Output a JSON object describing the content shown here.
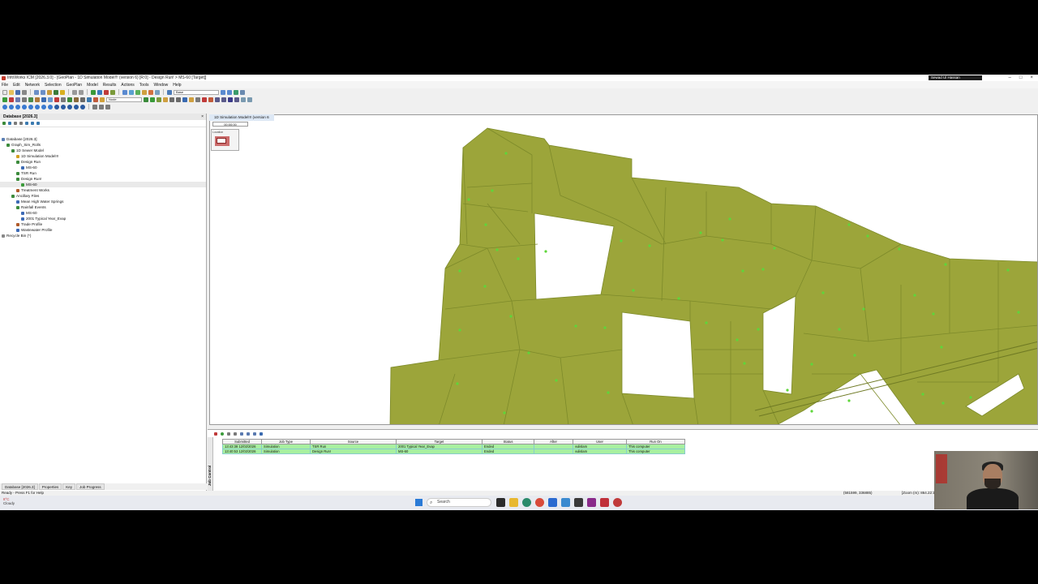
{
  "window": {
    "title": "InfoWorks ICM [2026.3.0] - [GeoPlan - 1D Simulation Model!!! (version 6) [R:0] - Design Run! > MS-60 [Target]]",
    "user": "Sewad Ul Hassan",
    "buttons": [
      "–",
      "□",
      "×"
    ]
  },
  "menu": [
    "File",
    "Edit",
    "Network",
    "Selection",
    "GeoPlan",
    "Model",
    "Results",
    "Actions",
    "Tools",
    "Window",
    "Help"
  ],
  "toolbar": {
    "node_select": "Node",
    "base_select": "Base"
  },
  "database_panel": {
    "title": "Database [2026.3]",
    "close": "×",
    "tree": [
      {
        "label": "Database [2026.3]",
        "level": 0,
        "color": "#5b7fb5"
      },
      {
        "label": "Graph_Sim_Rolls",
        "level": 1,
        "color": "#3c8b3c"
      },
      {
        "label": "1D Sewer Model",
        "level": 2,
        "color": "#3c8b3c"
      },
      {
        "label": "1D Simulation Model!!!",
        "level": 3,
        "color": "#d4a020"
      },
      {
        "label": "Design Run",
        "level": 3,
        "color": "#3c8b3c"
      },
      {
        "label": "MS-60",
        "level": 4,
        "color": "#3c6ab5"
      },
      {
        "label": "TSR Run",
        "level": 3,
        "color": "#3c8b3c"
      },
      {
        "label": "Design Run!",
        "level": 3,
        "color": "#3c8b3c"
      },
      {
        "label": "MS-60",
        "level": 4,
        "color": "#3c9b3c",
        "selected": true
      },
      {
        "label": "Treatment Works",
        "level": 3,
        "color": "#b05a2a"
      },
      {
        "label": "Ancillary Files",
        "level": 2,
        "color": "#3c8b3c"
      },
      {
        "label": "Mean High Water Springs",
        "level": 3,
        "color": "#3c6ab5"
      },
      {
        "label": "Rainfall Events",
        "level": 3,
        "color": "#3c8b3c"
      },
      {
        "label": "MS-60",
        "level": 4,
        "color": "#3c6ab5"
      },
      {
        "label": "2001 Typical Year_Evap",
        "level": 4,
        "color": "#3c6ab5"
      },
      {
        "label": "Trade Profile",
        "level": 3,
        "color": "#b05a2a"
      },
      {
        "label": "Wastewater Profile",
        "level": 3,
        "color": "#3c6ab5"
      },
      {
        "label": "Recycle Bin (*)",
        "level": 0,
        "color": "#888888"
      }
    ],
    "tabs": [
      "Database [2026.3]",
      "Properties",
      "Key",
      "Job Progress"
    ]
  },
  "geoplan": {
    "tab_label": "1D Simulation Model!!! (version 6",
    "time": "00:00:00",
    "locator_label": "Location",
    "polygon_fill": "#9ca53a",
    "polygon_stroke": "#7d8a2a",
    "node_color": "#5ed63a"
  },
  "job_control": {
    "side_label": "Job Control",
    "columns": [
      "Submitted",
      "Job Type",
      "Source",
      "Target",
      "Status",
      "After",
      "User",
      "Run On"
    ],
    "rows": [
      [
        "13:43:38 12/02/2026",
        "Simulation",
        "TSR Run",
        "2001 Typical Year_Evap",
        "Ended",
        "",
        "vulislam",
        "This computer"
      ],
      [
        "13:40:53 12/02/2026",
        "Simulation",
        "Design Run!",
        "MS-60",
        "Ended",
        "",
        "vulislam",
        "This computer"
      ]
    ]
  },
  "status": {
    "left": "Ready - Press F1 for Help",
    "coords": "(581599, 336885)",
    "zoom": "[Zoom (m): 864.22:1]"
  },
  "taskbar": {
    "weather_temp": "8°C",
    "weather_desc": "Cloudy",
    "search_placeholder": "Search"
  }
}
